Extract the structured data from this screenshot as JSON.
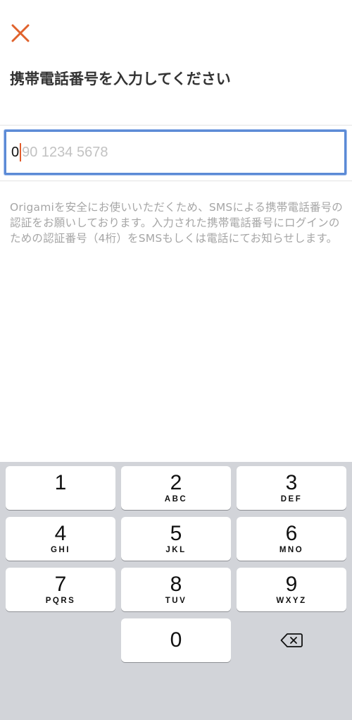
{
  "header": {
    "close_icon": "close-icon",
    "close_color": "#e0622c",
    "title": "携帯電話番号を入力してください"
  },
  "phone_field": {
    "value": "0",
    "placeholder": "90 1234 5678",
    "focus_color": "#5b8ad6",
    "caret_color": "#e25c2c"
  },
  "note": "Origamiを安全にお使いいただくため、SMSによる携帯電話番号の認証をお願いしております。入力された携帯電話番号にログインのための認証番号（4桁）をSMSもしくは電話にてお知らせします。",
  "keypad": {
    "keys": [
      {
        "digit": "1",
        "letters": ""
      },
      {
        "digit": "2",
        "letters": "ABC"
      },
      {
        "digit": "3",
        "letters": "DEF"
      },
      {
        "digit": "4",
        "letters": "GHI"
      },
      {
        "digit": "5",
        "letters": "JKL"
      },
      {
        "digit": "6",
        "letters": "MNO"
      },
      {
        "digit": "7",
        "letters": "PQRS"
      },
      {
        "digit": "8",
        "letters": "TUV"
      },
      {
        "digit": "9",
        "letters": "WXYZ"
      },
      {
        "digit": "0",
        "letters": ""
      }
    ],
    "backspace_icon": "backspace-icon"
  }
}
